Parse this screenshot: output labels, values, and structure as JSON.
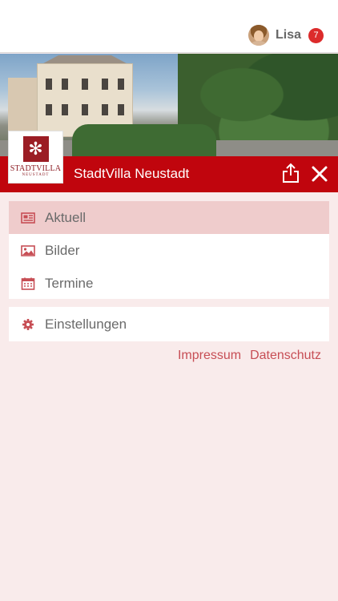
{
  "user": {
    "name": "Lisa",
    "notifications": "7"
  },
  "header": {
    "title": "StadtVilla Neustadt",
    "logo_text": "STADTVILLA",
    "logo_sub": "NEUSTADT"
  },
  "menu": {
    "items": [
      {
        "label": "Aktuell",
        "icon": "newspaper-icon",
        "active": true
      },
      {
        "label": "Bilder",
        "icon": "image-icon",
        "active": false
      },
      {
        "label": "Termine",
        "icon": "calendar-icon",
        "active": false
      }
    ],
    "settings": {
      "label": "Einstellungen",
      "icon": "gear-icon"
    }
  },
  "footer_links": {
    "impressum": "Impressum",
    "datenschutz": "Datenschutz"
  },
  "colors": {
    "brand": "#c0050d",
    "accent": "#c74e55",
    "background": "#f9ebeb",
    "active_item": "#efcccc"
  }
}
